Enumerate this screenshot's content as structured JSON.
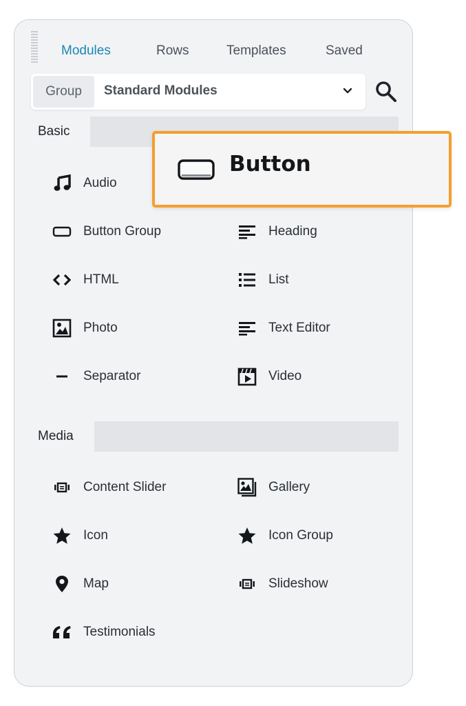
{
  "tabs": [
    {
      "label": "Modules",
      "active": true
    },
    {
      "label": "Rows",
      "active": false
    },
    {
      "label": "Templates",
      "active": false
    },
    {
      "label": "Saved",
      "active": false
    }
  ],
  "group_select": {
    "label": "Group",
    "value": "Standard Modules"
  },
  "sections": [
    {
      "title": "Basic",
      "modules": [
        {
          "label": "Audio",
          "icon": "music-note-icon"
        },
        {
          "label": "Button Group",
          "icon": "button-group-icon"
        },
        {
          "label": "Heading",
          "icon": "heading-icon"
        },
        {
          "label": "HTML",
          "icon": "code-icon"
        },
        {
          "label": "List",
          "icon": "list-icon"
        },
        {
          "label": "Photo",
          "icon": "photo-icon"
        },
        {
          "label": "Text Editor",
          "icon": "text-editor-icon"
        },
        {
          "label": "Separator",
          "icon": "separator-icon"
        },
        {
          "label": "Video",
          "icon": "video-icon"
        }
      ]
    },
    {
      "title": "Media",
      "modules": [
        {
          "label": "Content Slider",
          "icon": "slider-icon"
        },
        {
          "label": "Gallery",
          "icon": "gallery-icon"
        },
        {
          "label": "Icon",
          "icon": "star-icon"
        },
        {
          "label": "Icon Group",
          "icon": "star-icon"
        },
        {
          "label": "Map",
          "icon": "map-pin-icon"
        },
        {
          "label": "Slideshow",
          "icon": "slider-icon"
        },
        {
          "label": "Testimonials",
          "icon": "quote-icon"
        }
      ]
    }
  ],
  "drag_preview": {
    "label": "Button",
    "icon": "button-icon",
    "border_color": "#f59e2d"
  },
  "colors": {
    "accent": "#1c86b4",
    "panel_bg": "#f2f3f5",
    "section_bar": "#e2e4e8"
  }
}
